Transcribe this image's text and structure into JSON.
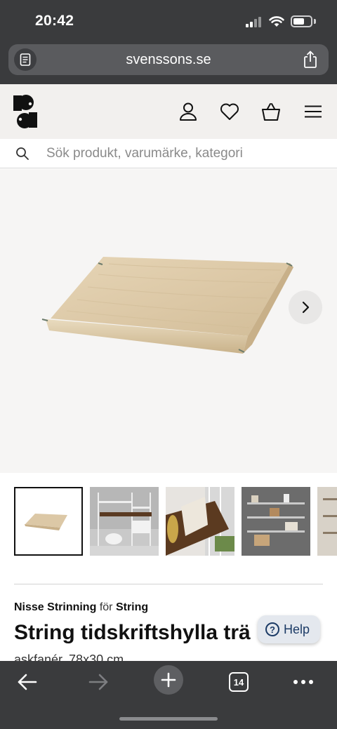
{
  "status_bar": {
    "time": "20:42"
  },
  "browser": {
    "url": "svenssons.se",
    "tab_count": "14"
  },
  "site": {
    "search_placeholder": "Sök produkt, varumärke, kategori"
  },
  "product": {
    "designer": "Nisse Strinning",
    "for_word": "för",
    "brand": "String",
    "title": "String tidskriftshylla trä",
    "subtitle": "askfanér, 78x30 cm"
  },
  "help": {
    "label": "Help",
    "icon_glyph": "?"
  },
  "thumbnails": [
    {
      "name": "thumb-shelf-ash",
      "active": true
    },
    {
      "name": "thumb-room-white",
      "active": false
    },
    {
      "name": "thumb-magazines",
      "active": false
    },
    {
      "name": "thumb-grey-wall",
      "active": false
    },
    {
      "name": "thumb-partial",
      "active": false
    }
  ],
  "colors": {
    "browser_chrome": "#3a3b3d",
    "header_bg": "#f2f0ee",
    "help_text": "#1c3b66"
  }
}
